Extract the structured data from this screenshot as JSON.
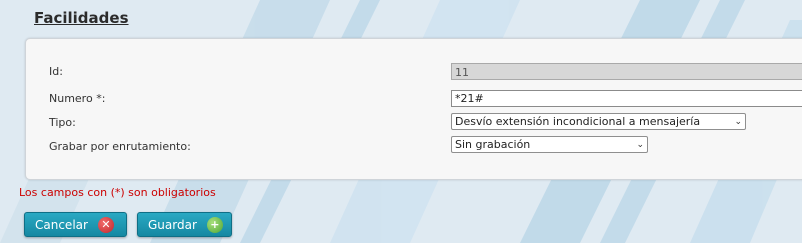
{
  "page": {
    "title": "Facilidades"
  },
  "form": {
    "id": {
      "label": "Id:",
      "value": "11"
    },
    "numero": {
      "label": "Numero *:",
      "value": "*21#"
    },
    "tipo": {
      "label": "Tipo:",
      "value": "Desvío extensión incondicional a mensajería"
    },
    "grabar": {
      "label": "Grabar por enrutamiento:",
      "value": "Sin grabación"
    }
  },
  "note": "Los campos con (*) son obligatorios",
  "buttons": {
    "cancel": {
      "label": "Cancelar",
      "icon": "close-icon",
      "color": "#1a96b0"
    },
    "save": {
      "label": "Guardar",
      "icon": "plus-icon",
      "color": "#1a96b0"
    }
  },
  "colors": {
    "required_note": "#cc0000",
    "panel_bg": "#f7f7f7"
  }
}
